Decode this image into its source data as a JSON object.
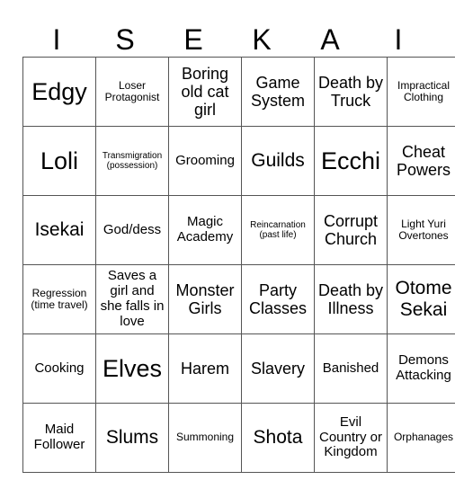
{
  "title_letters": [
    "I",
    "S",
    "E",
    "K",
    "A",
    "I"
  ],
  "rows": [
    [
      {
        "text": "Edgy",
        "size": "xxl"
      },
      {
        "text": "Loser Protagonist",
        "size": "sm"
      },
      {
        "text": "Boring old cat girl",
        "size": "lg"
      },
      {
        "text": "Game System",
        "size": "lg"
      },
      {
        "text": "Death by Truck",
        "size": "lg"
      },
      {
        "text": "Impractical Clothing",
        "size": "sm"
      }
    ],
    [
      {
        "text": "Loli",
        "size": "xxl"
      },
      {
        "text": "Transmigration (possession)",
        "size": "xs"
      },
      {
        "text": "Grooming",
        "size": "md"
      },
      {
        "text": "Guilds",
        "size": "xl"
      },
      {
        "text": "Ecchi",
        "size": "xxl"
      },
      {
        "text": "Cheat Powers",
        "size": "lg"
      }
    ],
    [
      {
        "text": "Isekai",
        "size": "xl"
      },
      {
        "text": "God/dess",
        "size": "md"
      },
      {
        "text": "Magic Academy",
        "size": "md"
      },
      {
        "text": "Reincarnation (past life)",
        "size": "xs"
      },
      {
        "text": "Corrupt Church",
        "size": "lg"
      },
      {
        "text": "Light Yuri Overtones",
        "size": "sm"
      }
    ],
    [
      {
        "text": "Regression (time travel)",
        "size": "sm"
      },
      {
        "text": "Saves a girl and she falls in love",
        "size": "md"
      },
      {
        "text": "Monster Girls",
        "size": "lg"
      },
      {
        "text": "Party Classes",
        "size": "lg"
      },
      {
        "text": "Death by Illness",
        "size": "lg"
      },
      {
        "text": "Otome Sekai",
        "size": "xl"
      }
    ],
    [
      {
        "text": "Cooking",
        "size": "md"
      },
      {
        "text": "Elves",
        "size": "xxl"
      },
      {
        "text": "Harem",
        "size": "lg"
      },
      {
        "text": "Slavery",
        "size": "lg"
      },
      {
        "text": "Banished",
        "size": "md"
      },
      {
        "text": "Demons Attacking",
        "size": "md"
      }
    ],
    [
      {
        "text": "Maid Follower",
        "size": "md"
      },
      {
        "text": "Slums",
        "size": "xl"
      },
      {
        "text": "Summoning",
        "size": "sm"
      },
      {
        "text": "Shota",
        "size": "xl"
      },
      {
        "text": "Evil Country or Kingdom",
        "size": "md"
      },
      {
        "text": "Orphanages",
        "size": "sm"
      }
    ]
  ]
}
